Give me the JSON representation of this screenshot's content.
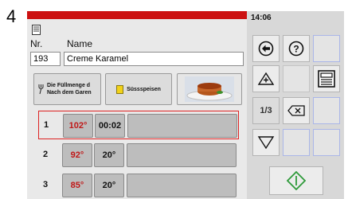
{
  "step_number": "4",
  "status": {
    "time": "14:06"
  },
  "recipe": {
    "nr_label": "Nr.",
    "name_label": "Name",
    "number": "193",
    "name": "Creme Karamel"
  },
  "tiles": {
    "fill_text_line1": "Die Füllmenge d",
    "fill_text_line2": "Nach dem Garen",
    "category": "Süssspeisen"
  },
  "steps": [
    {
      "index": "1",
      "temperature": "102°",
      "time": "00:02",
      "active": true
    },
    {
      "index": "2",
      "temperature": "92°",
      "time": "20°",
      "active": false
    },
    {
      "index": "3",
      "temperature": "85°",
      "time": "20°",
      "active": false
    }
  ],
  "pager": {
    "page": "1/3"
  },
  "icons": {
    "document": "document-icon",
    "back": "arrow-left-circle-icon",
    "help": "question-icon",
    "up": "triangle-up-plus-icon",
    "save": "save-disk-icon",
    "delete": "backspace-icon",
    "down": "triangle-down-icon",
    "start": "diamond-start-icon"
  },
  "colors": {
    "accent_red": "#cc1111",
    "temperature_red": "#c01818",
    "start_green": "#2e9a3a",
    "panel_gray": "#e9e9e9"
  }
}
